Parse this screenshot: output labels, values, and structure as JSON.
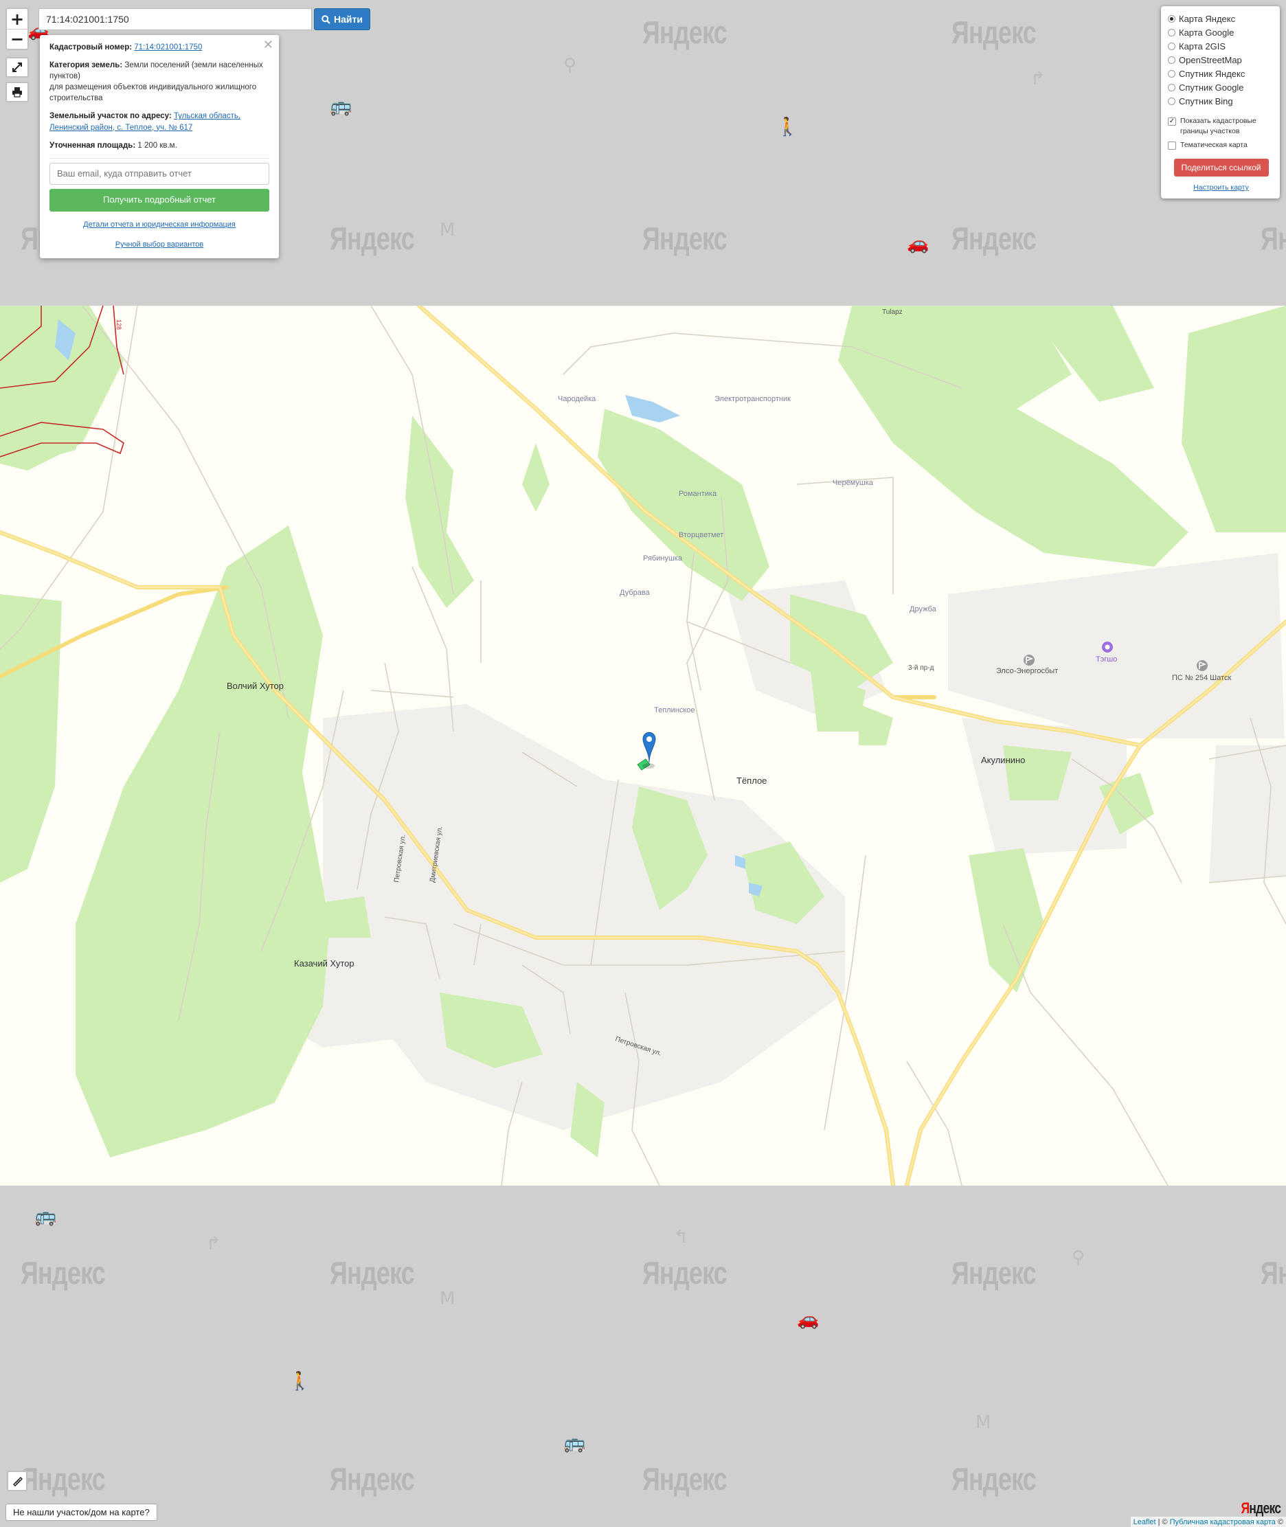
{
  "search": {
    "value": "71:14:021001:1750",
    "button_label": "Найти"
  },
  "zoom": {
    "in_label": "+",
    "out_label": "−"
  },
  "popup": {
    "cadastral_label": "Кадастровый номер:",
    "cadastral_value": "71:14:021001:1750",
    "category_label": "Категория земель:",
    "category_value": "Земли поселений (земли населенных пунктов)",
    "category_use": "для размещения объектов индивидуального жилищного строительства",
    "address_label": "Земельный участок по адресу:",
    "address_value": "Тульская область, Ленинский район, с. Теплое, уч. № 617",
    "area_label": "Уточненная площадь:",
    "area_value": "1 200 кв.м.",
    "email_placeholder": "Ваш email, куда отправить отчет",
    "report_button": "Получить подробный отчет",
    "details_link": "Детали отчета и юридическая информация",
    "manual_link": "Ручной выбор вариантов"
  },
  "layers": {
    "items": [
      {
        "label": "Карта Яндекс",
        "selected": true
      },
      {
        "label": "Карта Google",
        "selected": false
      },
      {
        "label": "Карта 2GIS",
        "selected": false
      },
      {
        "label": "OpenStreetMap",
        "selected": false
      },
      {
        "label": "Спутник Яндекс",
        "selected": false
      },
      {
        "label": "Спутник Google",
        "selected": false
      },
      {
        "label": "Спутник Bing",
        "selected": false
      }
    ],
    "show_boundaries": "Показать кадастровые границы участков",
    "thematic": "Тематическая карта",
    "share_button": "Поделиться ссылкой",
    "configure_link": "Настроить карту"
  },
  "map": {
    "watermark": "Яндекс",
    "labels": {
      "volchiy": "Волчий Хутор",
      "kazachiy": "Казачий Хутор",
      "teploe": "Тёплое",
      "akulinino": "Акулинино",
      "chardeika": "Чародейка",
      "electro": "Электротранспортник",
      "romantika": "Романтика",
      "cheremushka": "Черёмушка",
      "vtortsvetmet": "Вторцветмет",
      "ryabinushka": "Рябинушка",
      "dubrava": "Дубрава",
      "druzhba": "Дружба",
      "teplinskoe": "Теплинское",
      "tulapz": "Tulapz",
      "third_pr": "3-й пр-д",
      "elso": "Элсо-Энергосбыт",
      "tegsho": "Тэгшо",
      "ps254": "ПС № 254 Шатск",
      "petrovskaya1": "Петровская ул.",
      "dmitrievskaya": "Дмитриевская ул.",
      "petrovskaya2": "Петровская ул.",
      "parcel_num": "128"
    }
  },
  "bottom": {
    "not_found": "Не нашли участок/дом на карте?",
    "attribution_leaflet": "Leaflet",
    "attribution_sep": "| ©",
    "attribution_pkk": "Публичная кадастровая карта",
    "attribution_end": "©",
    "logo_main": "Я",
    "logo_rest": "ндекс"
  },
  "colors": {
    "forest": "#cfeeb4",
    "road": "#fbe58f",
    "settlement": "#f1efeb",
    "map_base": "#fffef6",
    "pattern_bg": "#cfcfcf",
    "cadastral_red": "#c62828",
    "marker": "#2979d2",
    "parcel": "#3ccf6e"
  }
}
